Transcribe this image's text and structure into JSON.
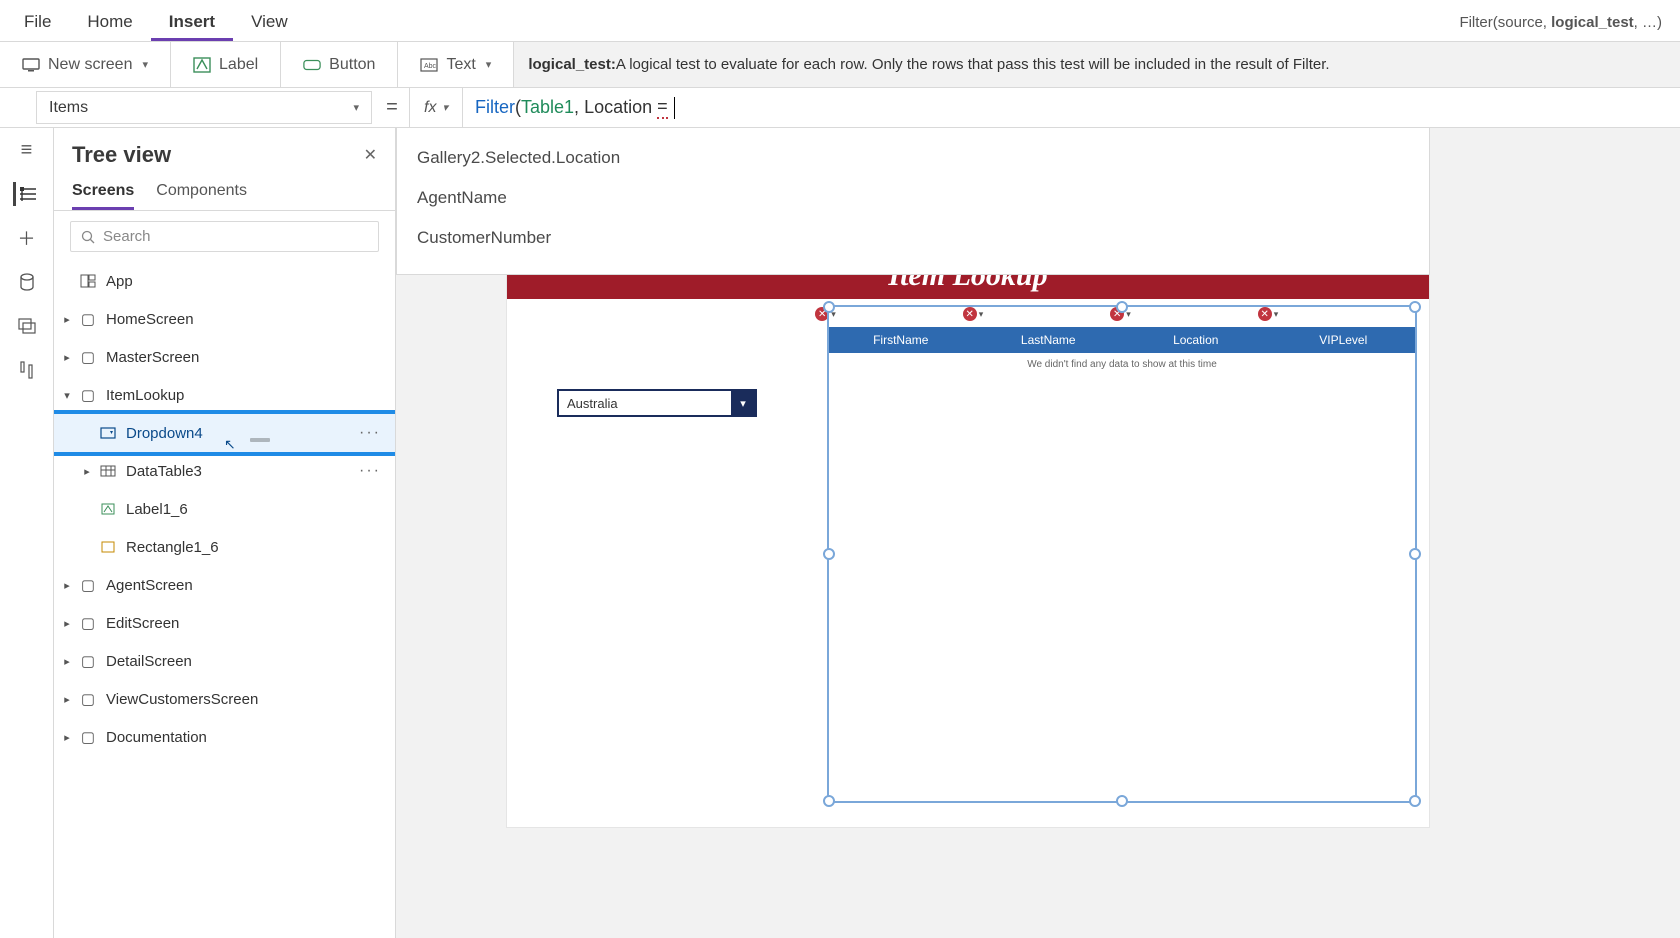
{
  "menubar": {
    "tabs": [
      "File",
      "Home",
      "Insert",
      "View"
    ],
    "active": "Insert"
  },
  "signature_hint": "Filter(source, <b>logical_test</b>, …)",
  "ribbon": {
    "new_screen": "New screen",
    "label": "Label",
    "button": "Button",
    "text": "Text"
  },
  "help_line": "<b>logical_test:</b> A logical test to evaluate for each row. Only the rows that pass this test will be included in the result of Filter.",
  "property_dropdown": "Items",
  "formula": {
    "fn": "Filter",
    "tbl": "Table1",
    "field": "Location",
    "op": "="
  },
  "autocomplete": [
    "Gallery2.Selected.Location",
    "AgentName",
    "CustomerNumber"
  ],
  "tree": {
    "title": "Tree view",
    "tabs": [
      "Screens",
      "Components"
    ],
    "active_tab": "Screens",
    "search_placeholder": "Search",
    "app": "App",
    "nodes": {
      "home": "HomeScreen",
      "master": "MasterScreen",
      "itemlookup": "ItemLookup",
      "dropdown4": "Dropdown4",
      "datatable3": "DataTable3",
      "label16": "Label1_6",
      "rect16": "Rectangle1_6",
      "agent": "AgentScreen",
      "edit": "EditScreen",
      "detail": "DetailScreen",
      "viewcust": "ViewCustomersScreen",
      "doc": "Documentation"
    }
  },
  "app_preview": {
    "title": "Item Lookup",
    "dropdown_value": "Australia",
    "columns": [
      "FirstName",
      "LastName",
      "Location",
      "VIPLevel"
    ],
    "empty_msg": "We didn't find any data to show at this time"
  }
}
